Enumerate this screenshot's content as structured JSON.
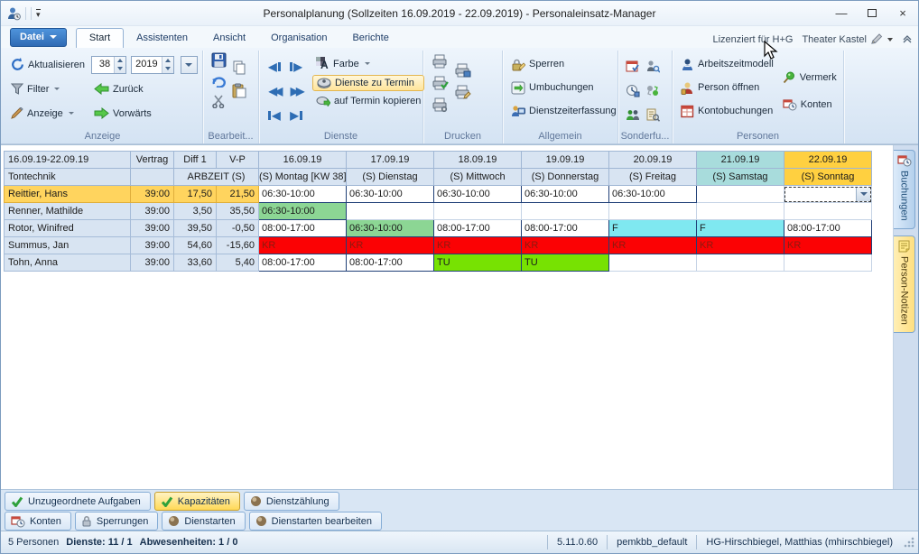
{
  "window": {
    "title": "Personalplanung (Sollzeiten 16.09.2019 - 22.09.2019) - Personaleinsatz-Manager"
  },
  "menu": {
    "file_label": "Datei",
    "tabs": [
      "Start",
      "Assistenten",
      "Ansicht",
      "Organisation",
      "Berichte"
    ],
    "active_tab": "Start",
    "licensed": "Lizenziert für H+G",
    "profile": "Theater Kastel"
  },
  "ribbon": {
    "anzeige": {
      "label": "Anzeige",
      "refresh": "Aktualisieren",
      "week": "38",
      "year": "2019",
      "filter": "Filter",
      "back": "Zurück",
      "display": "Anzeige",
      "forward": "Vorwärts"
    },
    "bearbeiten": {
      "label": "Bearbeit..."
    },
    "dienste": {
      "label": "Dienste",
      "color": "Farbe",
      "to_termin": "Dienste zu Termin",
      "copy_to_termin": "auf Termin kopieren"
    },
    "drucken": {
      "label": "Drucken"
    },
    "allgemein": {
      "label": "Allgemein",
      "items": [
        "Sperren",
        "Umbuchungen",
        "Dienstzeiterfassung"
      ]
    },
    "sonderfunktionen": {
      "label": "Sonderfu..."
    },
    "personen": {
      "label": "Personen",
      "items": [
        "Arbeitszeitmodell",
        "Person öffnen",
        "Kontobuchungen",
        "Vermerk",
        "Konten"
      ]
    }
  },
  "table": {
    "range": "16.09.19-22.09.19",
    "group": "Tontechnik",
    "columns": [
      "Vertrag",
      "Diff 1",
      "V-P"
    ],
    "arbzeit": "ARBZEIT (S)",
    "days": [
      {
        "date": "16.09.19",
        "name": "(S) Montag [KW 38]",
        "kind": "weekday"
      },
      {
        "date": "17.09.19",
        "name": "(S) Dienstag",
        "kind": "weekday"
      },
      {
        "date": "18.09.19",
        "name": "(S) Mittwoch",
        "kind": "weekday"
      },
      {
        "date": "19.09.19",
        "name": "(S) Donnerstag",
        "kind": "weekday"
      },
      {
        "date": "20.09.19",
        "name": "(S) Freitag",
        "kind": "weekday"
      },
      {
        "date": "21.09.19",
        "name": "(S) Samstag",
        "kind": "saturday"
      },
      {
        "date": "22.09.19",
        "name": "(S) Sonntag",
        "kind": "sunday"
      }
    ],
    "rows": [
      {
        "name": "Reittier, Hans",
        "vertrag": "39:00",
        "diff1": "17,50",
        "vp": "21,50",
        "selected": true,
        "cells": [
          {
            "text": "06:30-10:00",
            "style": "plain"
          },
          {
            "text": "06:30-10:00",
            "style": "plain"
          },
          {
            "text": "06:30-10:00",
            "style": "plain"
          },
          {
            "text": "06:30-10:00",
            "style": "plain"
          },
          {
            "text": "06:30-10:00",
            "style": "plain"
          },
          {
            "text": "",
            "style": "empty"
          },
          {
            "text": "",
            "style": "combo"
          }
        ]
      },
      {
        "name": "Renner, Mathilde",
        "vertrag": "39:00",
        "diff1": "3,50",
        "vp": "35,50",
        "selected": false,
        "cells": [
          {
            "text": "06:30-10:00",
            "style": "green"
          },
          {
            "text": "",
            "style": "empty"
          },
          {
            "text": "",
            "style": "empty"
          },
          {
            "text": "",
            "style": "empty"
          },
          {
            "text": "",
            "style": "empty"
          },
          {
            "text": "",
            "style": "empty"
          },
          {
            "text": "",
            "style": "empty"
          }
        ]
      },
      {
        "name": "Rotor, Winifred",
        "vertrag": "39:00",
        "diff1": "39,50",
        "vp": "-0,50",
        "selected": false,
        "cells": [
          {
            "text": "08:00-17:00",
            "style": "plain"
          },
          {
            "text": "06:30-10:00",
            "style": "green"
          },
          {
            "text": "08:00-17:00",
            "style": "plain"
          },
          {
            "text": "08:00-17:00",
            "style": "plain"
          },
          {
            "text": "F",
            "style": "cyan"
          },
          {
            "text": "F",
            "style": "cyan"
          },
          {
            "text": "08:00-17:00",
            "style": "plain"
          }
        ]
      },
      {
        "name": "Summus, Jan",
        "vertrag": "39:00",
        "diff1": "54,60",
        "vp": "-15,60",
        "selected": false,
        "cells": [
          {
            "text": "KR",
            "style": "red"
          },
          {
            "text": "KR",
            "style": "red"
          },
          {
            "text": "KR",
            "style": "red"
          },
          {
            "text": "KR",
            "style": "red"
          },
          {
            "text": "KR",
            "style": "red"
          },
          {
            "text": "KR",
            "style": "red"
          },
          {
            "text": "KR",
            "style": "red"
          }
        ]
      },
      {
        "name": "Tohn, Anna",
        "vertrag": "39:00",
        "diff1": "33,60",
        "vp": "5,40",
        "selected": false,
        "cells": [
          {
            "text": "08:00-17:00",
            "style": "plain"
          },
          {
            "text": "08:00-17:00",
            "style": "plain"
          },
          {
            "text": "TU",
            "style": "lime"
          },
          {
            "text": "TU",
            "style": "lime"
          },
          {
            "text": "",
            "style": "empty"
          },
          {
            "text": "",
            "style": "empty"
          },
          {
            "text": "",
            "style": "empty"
          }
        ]
      }
    ]
  },
  "side_tabs": [
    {
      "label": "Buchungen"
    },
    {
      "label": "Person-Notizen"
    }
  ],
  "toolbar": {
    "row1": [
      {
        "label": "Unzugeordnete Aufgaben",
        "icon": "check-icon",
        "active": false
      },
      {
        "label": "Kapazitäten",
        "icon": "check-icon",
        "active": true
      },
      {
        "label": "Dienstzählung",
        "icon": "sphere-icon",
        "active": false
      }
    ],
    "row2": [
      {
        "label": "Konten",
        "icon": "account-clock-icon",
        "active": false
      },
      {
        "label": "Sperrungen",
        "icon": "lock-icon",
        "active": false
      },
      {
        "label": "Dienstarten",
        "icon": "sphere-icon",
        "active": false
      },
      {
        "label": "Dienstarten bearbeiten",
        "icon": "sphere-icon",
        "active": false
      }
    ]
  },
  "status": {
    "persons": "5 Personen",
    "dienste": "Dienste: 11 / 1",
    "abwesenheiten": "Abwesenheiten: 1 / 0",
    "version": "5.11.0.60",
    "database": "pemkbb_default",
    "user": "HG-Hirschbiegel, Matthias (mhirschbiegel)"
  },
  "colors": {
    "selected_row": "#ffd45e",
    "saturday_header": "#a8dcdc",
    "sunday_header": "#ffd040",
    "service_green": "#8cd694",
    "absence_red": "#fb0204",
    "flag_cyan": "#7fe8f0",
    "flag_lime": "#77e202"
  }
}
